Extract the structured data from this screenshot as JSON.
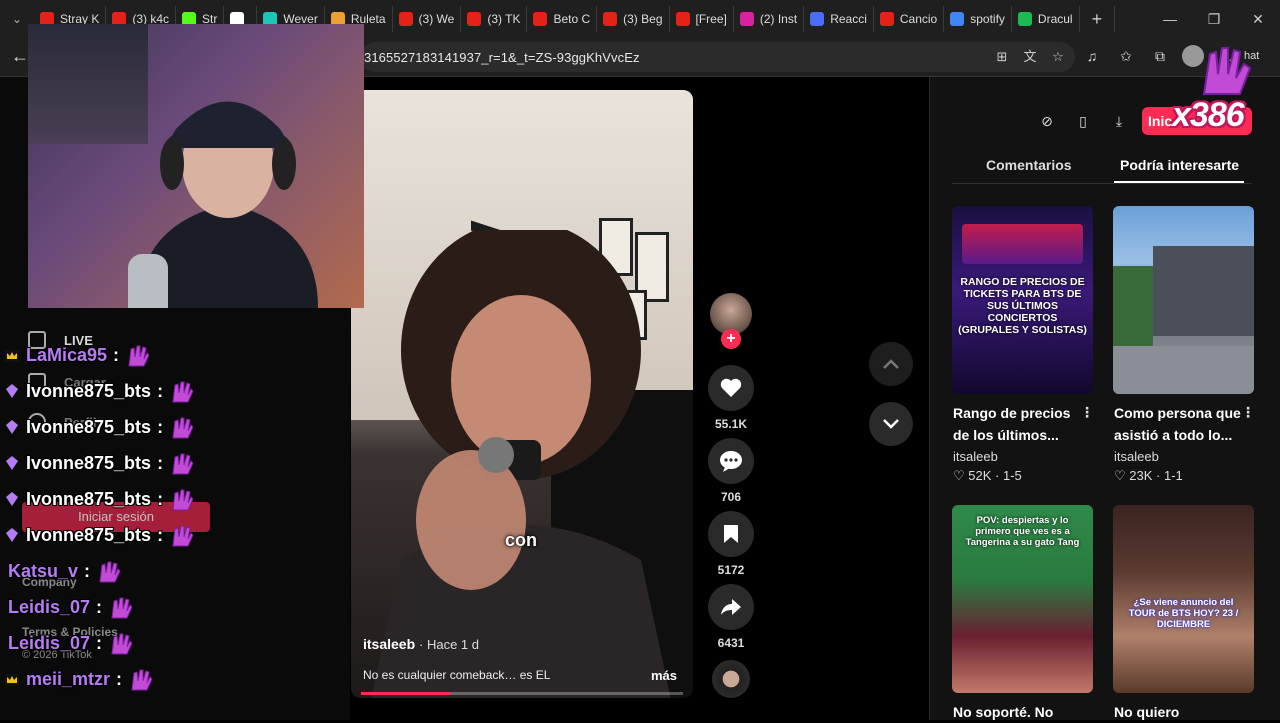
{
  "browser": {
    "tabs": [
      {
        "label": "Stray K",
        "color": "#e62117"
      },
      {
        "label": "(3) k4c",
        "color": "#e62117"
      },
      {
        "label": "Str",
        "color": "#53fc18"
      },
      {
        "label": "",
        "color": "#ffffff"
      },
      {
        "label": "Wever",
        "color": "#19c6b8"
      },
      {
        "label": "Ruleta",
        "color": "#f0a030"
      },
      {
        "label": "(3) We",
        "color": "#e62117"
      },
      {
        "label": "(3) TK",
        "color": "#e62117"
      },
      {
        "label": "Beto C",
        "color": "#e62117"
      },
      {
        "label": "(3) Beg",
        "color": "#e62117"
      },
      {
        "label": "[Free]",
        "color": "#e62117"
      },
      {
        "label": "(2) Inst",
        "color": "#d6249f"
      },
      {
        "label": "Reacci",
        "color": "#4a6cf7"
      },
      {
        "label": "Cancio",
        "color": "#e62117"
      },
      {
        "label": "spotify",
        "color": "#4285f4"
      },
      {
        "label": "Dracul",
        "color": "#1db954"
      }
    ],
    "url": "3165527183141937_r=1&_t=ZS-93ggKhVvcEz",
    "chat_label": "hat"
  },
  "left_nav": {
    "live": "LIVE",
    "upload": "Cargar",
    "profile": "Perfil",
    "login": "Iniciar sesión",
    "company": "Company",
    "terms": "Terms & Policies",
    "copyright": "© 2026 TikTok"
  },
  "chat": [
    {
      "user": "LaMica95",
      "sep": ":",
      "badge": "crown",
      "mod": true
    },
    {
      "user": "Ivonne875_bts",
      "sep": ":",
      "badge": "gem"
    },
    {
      "user": "Ivonne875_bts",
      "sep": ":",
      "badge": "gem"
    },
    {
      "user": "Ivonne875_bts",
      "sep": ":",
      "badge": "gem"
    },
    {
      "user": "Ivonne875_bts",
      "sep": ":",
      "badge": "gem"
    },
    {
      "user": "Ivonne875_bts",
      "sep": ":",
      "badge": "gem"
    },
    {
      "user": "Katsu_v",
      "sep": ":",
      "badge": ""
    },
    {
      "user": "Leidis_07",
      "sep": ":",
      "badge": ""
    },
    {
      "user": "Leidis_07",
      "sep": ":",
      "badge": ""
    },
    {
      "user": "meii_mtzr",
      "sep": ":",
      "badge": "crown"
    }
  ],
  "video": {
    "caption_word": "con",
    "author": "itsaleeb",
    "time": "· Hace 1 d",
    "description": "No es cualquier comeback… es EL",
    "more": "más",
    "progress": 0.28
  },
  "actions": {
    "likes": "55.1K",
    "comments": "706",
    "saves": "5172",
    "shares": "6431"
  },
  "right_panel": {
    "login_button": "Inic",
    "tab_comments": "Comentarios",
    "tab_interest": "Podría interesarte",
    "cards": [
      {
        "title_line1": "Rango de precios",
        "title_line2": "de los últimos...",
        "author": "itsaleeb",
        "stats": "52K · 1-5",
        "thumb_text": "RANGO DE PRECIOS DE TICKETS PARA BTS DE SUS ÚLTIMOS CONCIERTOS (GRUPALES Y SOLISTAS)"
      },
      {
        "title_line1": "Como persona que",
        "title_line2": "asistió a todo lo...",
        "author": "itsaleeb",
        "stats": "23K · 1-1",
        "thumb_text": ""
      },
      {
        "title_line1": "No soporté. No",
        "title_line2": "",
        "author": "",
        "stats": "",
        "thumb_text": "POV: despiertas y lo primero que ves es a Tangerina a su gato Tang"
      },
      {
        "title_line1": "No quiero",
        "title_line2": "",
        "author": "",
        "stats": "",
        "thumb_text": "¿Se viene anuncio del TOUR de BTS HOY? 23 / DICIEMBRE"
      }
    ]
  },
  "overlay": {
    "counter": "x386"
  },
  "colors": {
    "accent": "#fe2c55",
    "chat_purple": "#b67cf4",
    "panel_bg": "#121212"
  }
}
